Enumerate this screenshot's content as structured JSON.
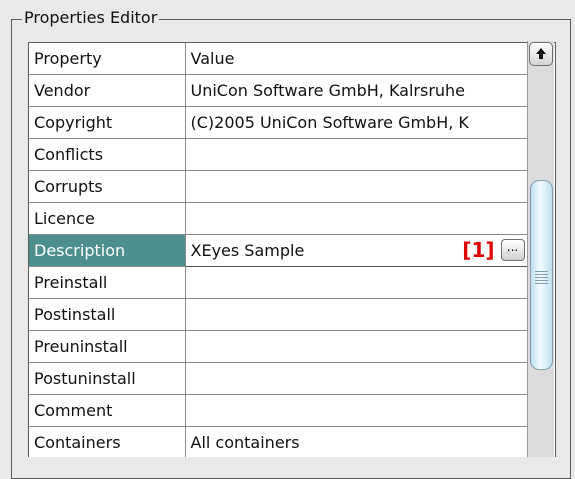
{
  "group_title": "Properties Editor",
  "table": {
    "headers": [
      "Property",
      "Value"
    ],
    "rows": [
      {
        "name": "Vendor",
        "value": "UniCon Software GmbH, Kalrsruhe"
      },
      {
        "name": "Copyright",
        "value": "(C)2005 UniCon Software GmbH, K"
      },
      {
        "name": "Conflicts",
        "value": ""
      },
      {
        "name": "Corrupts",
        "value": ""
      },
      {
        "name": "Licence",
        "value": ""
      },
      {
        "name": "Description",
        "value": "XEyes Sample"
      },
      {
        "name": "Preinstall",
        "value": ""
      },
      {
        "name": "Postinstall",
        "value": ""
      },
      {
        "name": "Preuninstall",
        "value": ""
      },
      {
        "name": "Postuninstall",
        "value": ""
      },
      {
        "name": "Comment",
        "value": ""
      },
      {
        "name": "Containers",
        "value": "All containers"
      }
    ],
    "selected_row": "Description"
  },
  "edit_button_label": "...",
  "marker_label": "[1]",
  "colors": {
    "selection": "#4d8f8f",
    "marker": "#e00000"
  }
}
